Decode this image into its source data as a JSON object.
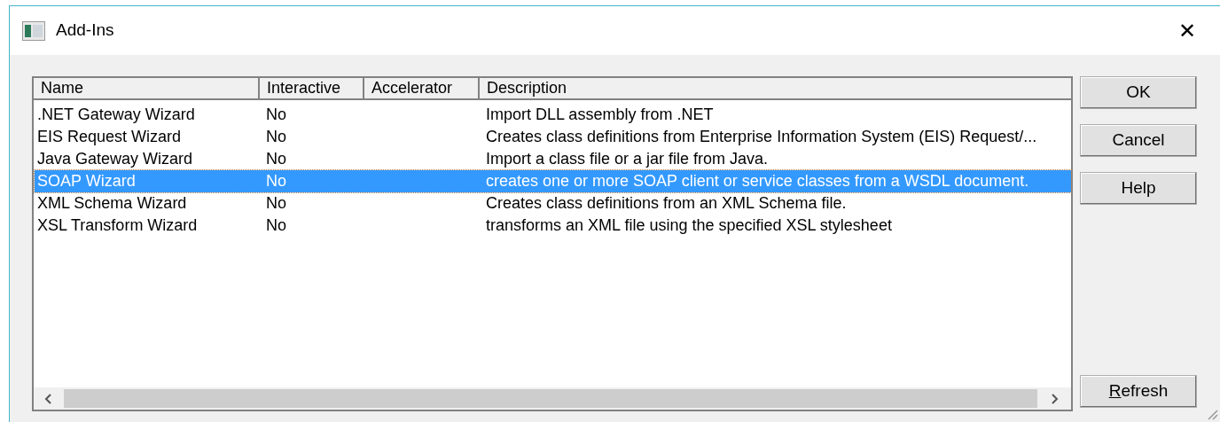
{
  "window": {
    "title": "Add-Ins",
    "close": "✕"
  },
  "list": {
    "columns": [
      "Name",
      "Interactive",
      "Accelerator",
      "Description"
    ],
    "rows": [
      {
        "cells": [
          ".NET Gateway Wizard",
          "No",
          "",
          "Import DLL assembly from .NET"
        ],
        "selected": false
      },
      {
        "cells": [
          "EIS Request Wizard",
          "No",
          "",
          "Creates class definitions from Enterprise Information System (EIS) Request/..."
        ],
        "selected": false
      },
      {
        "cells": [
          "Java Gateway Wizard",
          "No",
          "",
          "Import a class file or a jar file from Java."
        ],
        "selected": false
      },
      {
        "cells": [
          "SOAP Wizard",
          "No",
          "",
          "creates one or more SOAP client or service classes from a WSDL document."
        ],
        "selected": true
      },
      {
        "cells": [
          "XML Schema Wizard",
          "No",
          "",
          "Creates class definitions from an XML Schema file."
        ],
        "selected": false
      },
      {
        "cells": [
          "XSL Transform Wizard",
          "No",
          "",
          "transforms an XML file using the specified XSL stylesheet"
        ],
        "selected": false
      }
    ]
  },
  "buttons": [
    {
      "label": "OK",
      "underline_first": false
    },
    {
      "label": "Cancel",
      "underline_first": false
    },
    {
      "label": "Help",
      "underline_first": false
    }
  ],
  "refresh_button": {
    "label": "Refresh",
    "underline_first": true
  }
}
